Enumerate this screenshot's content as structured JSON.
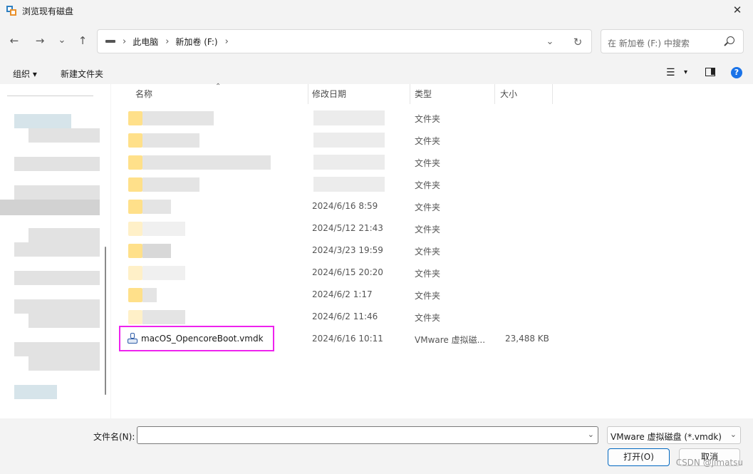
{
  "window": {
    "title": "浏览现有磁盘",
    "close_glyph": "✕"
  },
  "nav": {
    "back": "←",
    "forward": "→",
    "recent": "⌄",
    "up": "↑"
  },
  "address": {
    "crumbs": [
      "此电脑",
      "新加卷 (F:)"
    ],
    "separator": "›",
    "dropdown_glyph": "⌄",
    "refresh_glyph": "↻"
  },
  "search": {
    "placeholder": "在 新加卷 (F:) 中搜索"
  },
  "toolbar": {
    "organize": "组织 ▾",
    "new_folder": "新建文件夹",
    "view_glyph": "☰",
    "view_dd": "▾",
    "help_glyph": "?"
  },
  "columns": {
    "name": "名称",
    "date": "修改日期",
    "type": "类型",
    "size": "大小",
    "sort_glyph": "⌃"
  },
  "files": [
    {
      "date": "",
      "type": "文件夹",
      "size": ""
    },
    {
      "date": "",
      "type": "文件夹",
      "size": ""
    },
    {
      "date": "",
      "type": "文件夹",
      "size": ""
    },
    {
      "date": "",
      "type": "文件夹",
      "size": ""
    },
    {
      "date": "2024/6/16 8:59",
      "type": "文件夹",
      "size": ""
    },
    {
      "date": "2024/5/12 21:43",
      "type": "文件夹",
      "size": ""
    },
    {
      "date": "2024/3/23 19:59",
      "type": "文件夹",
      "size": ""
    },
    {
      "date": "2024/6/15 20:20",
      "type": "文件夹",
      "size": ""
    },
    {
      "date": "2024/6/2 1:17",
      "type": "文件夹",
      "size": ""
    },
    {
      "date": "2024/6/2 11:46",
      "type": "文件夹",
      "size": ""
    }
  ],
  "vmdk_file": {
    "name": "macOS_OpencoreBoot.vmdk",
    "date": "2024/6/16 10:11",
    "type": "VMware 虚拟磁...",
    "size": "23,488 KB"
  },
  "footer": {
    "filename_label": "文件名(N):",
    "filename_value": "",
    "dropdown_glyph": "⌄",
    "filetype": "VMware 虚拟磁盘 (*.vmdk)",
    "open_button": "打开(O)",
    "cancel_button": "取消",
    "watermark": "CSDN @jimatsu"
  },
  "colors": {
    "highlight": "#ee22ee",
    "accent": "#0067c0"
  }
}
